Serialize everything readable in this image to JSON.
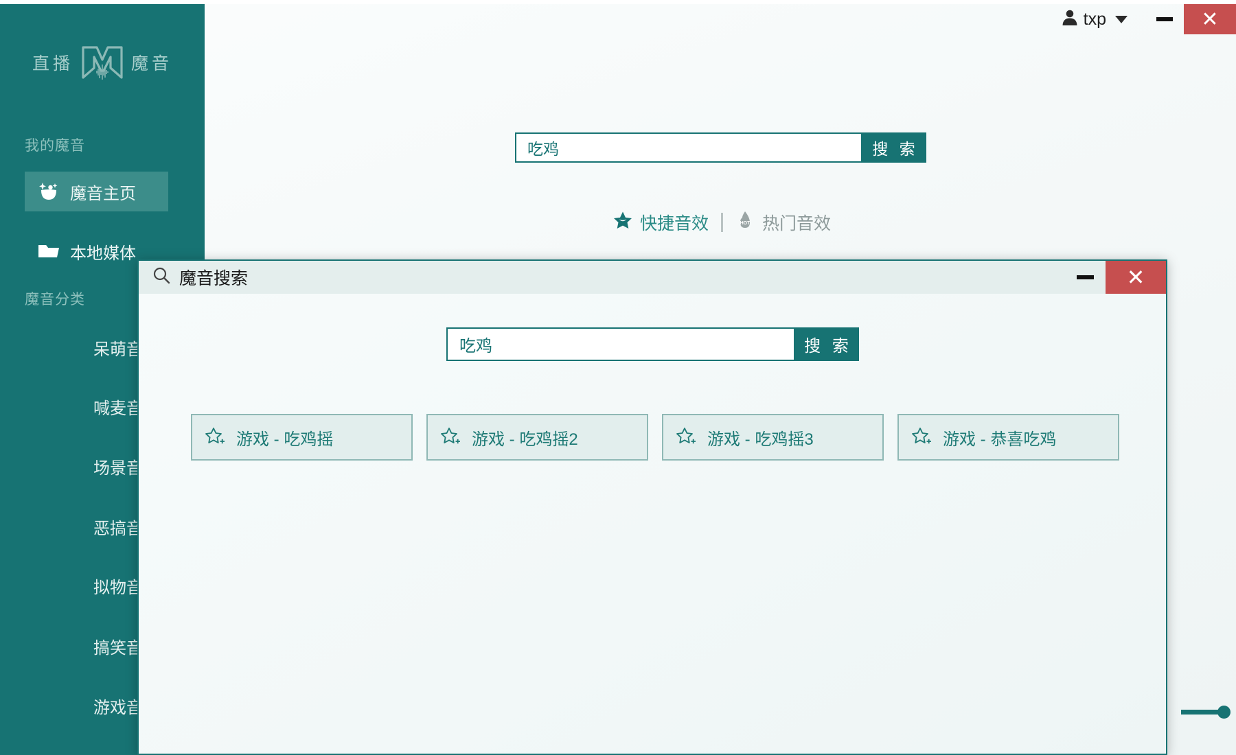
{
  "app": {
    "logo_left": "直播",
    "logo_right": "魔音",
    "logo_icon": "m-waveform-logo"
  },
  "titlebar": {
    "user_icon": "person-icon",
    "username": "txp",
    "caret_icon": "chevron-down-icon",
    "minimize_icon": "minimize-icon",
    "close_icon": "close-icon"
  },
  "sidebar": {
    "my_section_label": "我的魔音",
    "nav": [
      {
        "label": "魔音主页",
        "icon": "smiley-sparkle-icon",
        "active": true
      },
      {
        "label": "本地媒体",
        "icon": "folder-icon",
        "active": false
      }
    ],
    "category_section_label": "魔音分类",
    "categories": [
      "呆萌音效",
      "喊麦音效",
      "场景音效",
      "恶搞音效",
      "拟物音效",
      "搞笑音效",
      "游戏音效"
    ]
  },
  "main": {
    "search": {
      "value": "吃鸡",
      "placeholder": "",
      "button_label": "搜 索"
    },
    "tabs": [
      {
        "label": "快捷音效",
        "icon": "star-filled-icon",
        "active": true
      },
      {
        "label": "热门音效",
        "icon": "hot-flame-icon",
        "active": false
      }
    ],
    "tab_divider": "|"
  },
  "popup": {
    "title": "魔音搜索",
    "title_icon": "search-icon",
    "minimize_icon": "minimize-icon",
    "close_icon": "close-icon",
    "search": {
      "value": "吃鸡",
      "placeholder": "",
      "button_label": "搜 索"
    },
    "results": [
      {
        "label": "游戏 - 吃鸡摇",
        "icon": "star-plus-icon"
      },
      {
        "label": "游戏 - 吃鸡摇2",
        "icon": "star-plus-icon"
      },
      {
        "label": "游戏 - 吃鸡摇3",
        "icon": "star-plus-icon"
      },
      {
        "label": "游戏 - 恭喜吃鸡",
        "icon": "star-plus-icon"
      }
    ]
  },
  "colors": {
    "brand_teal": "#177373",
    "sidebar_active": "#3c8d8a",
    "close_red": "#c64f4f",
    "card_bg": "#e2eeed"
  }
}
